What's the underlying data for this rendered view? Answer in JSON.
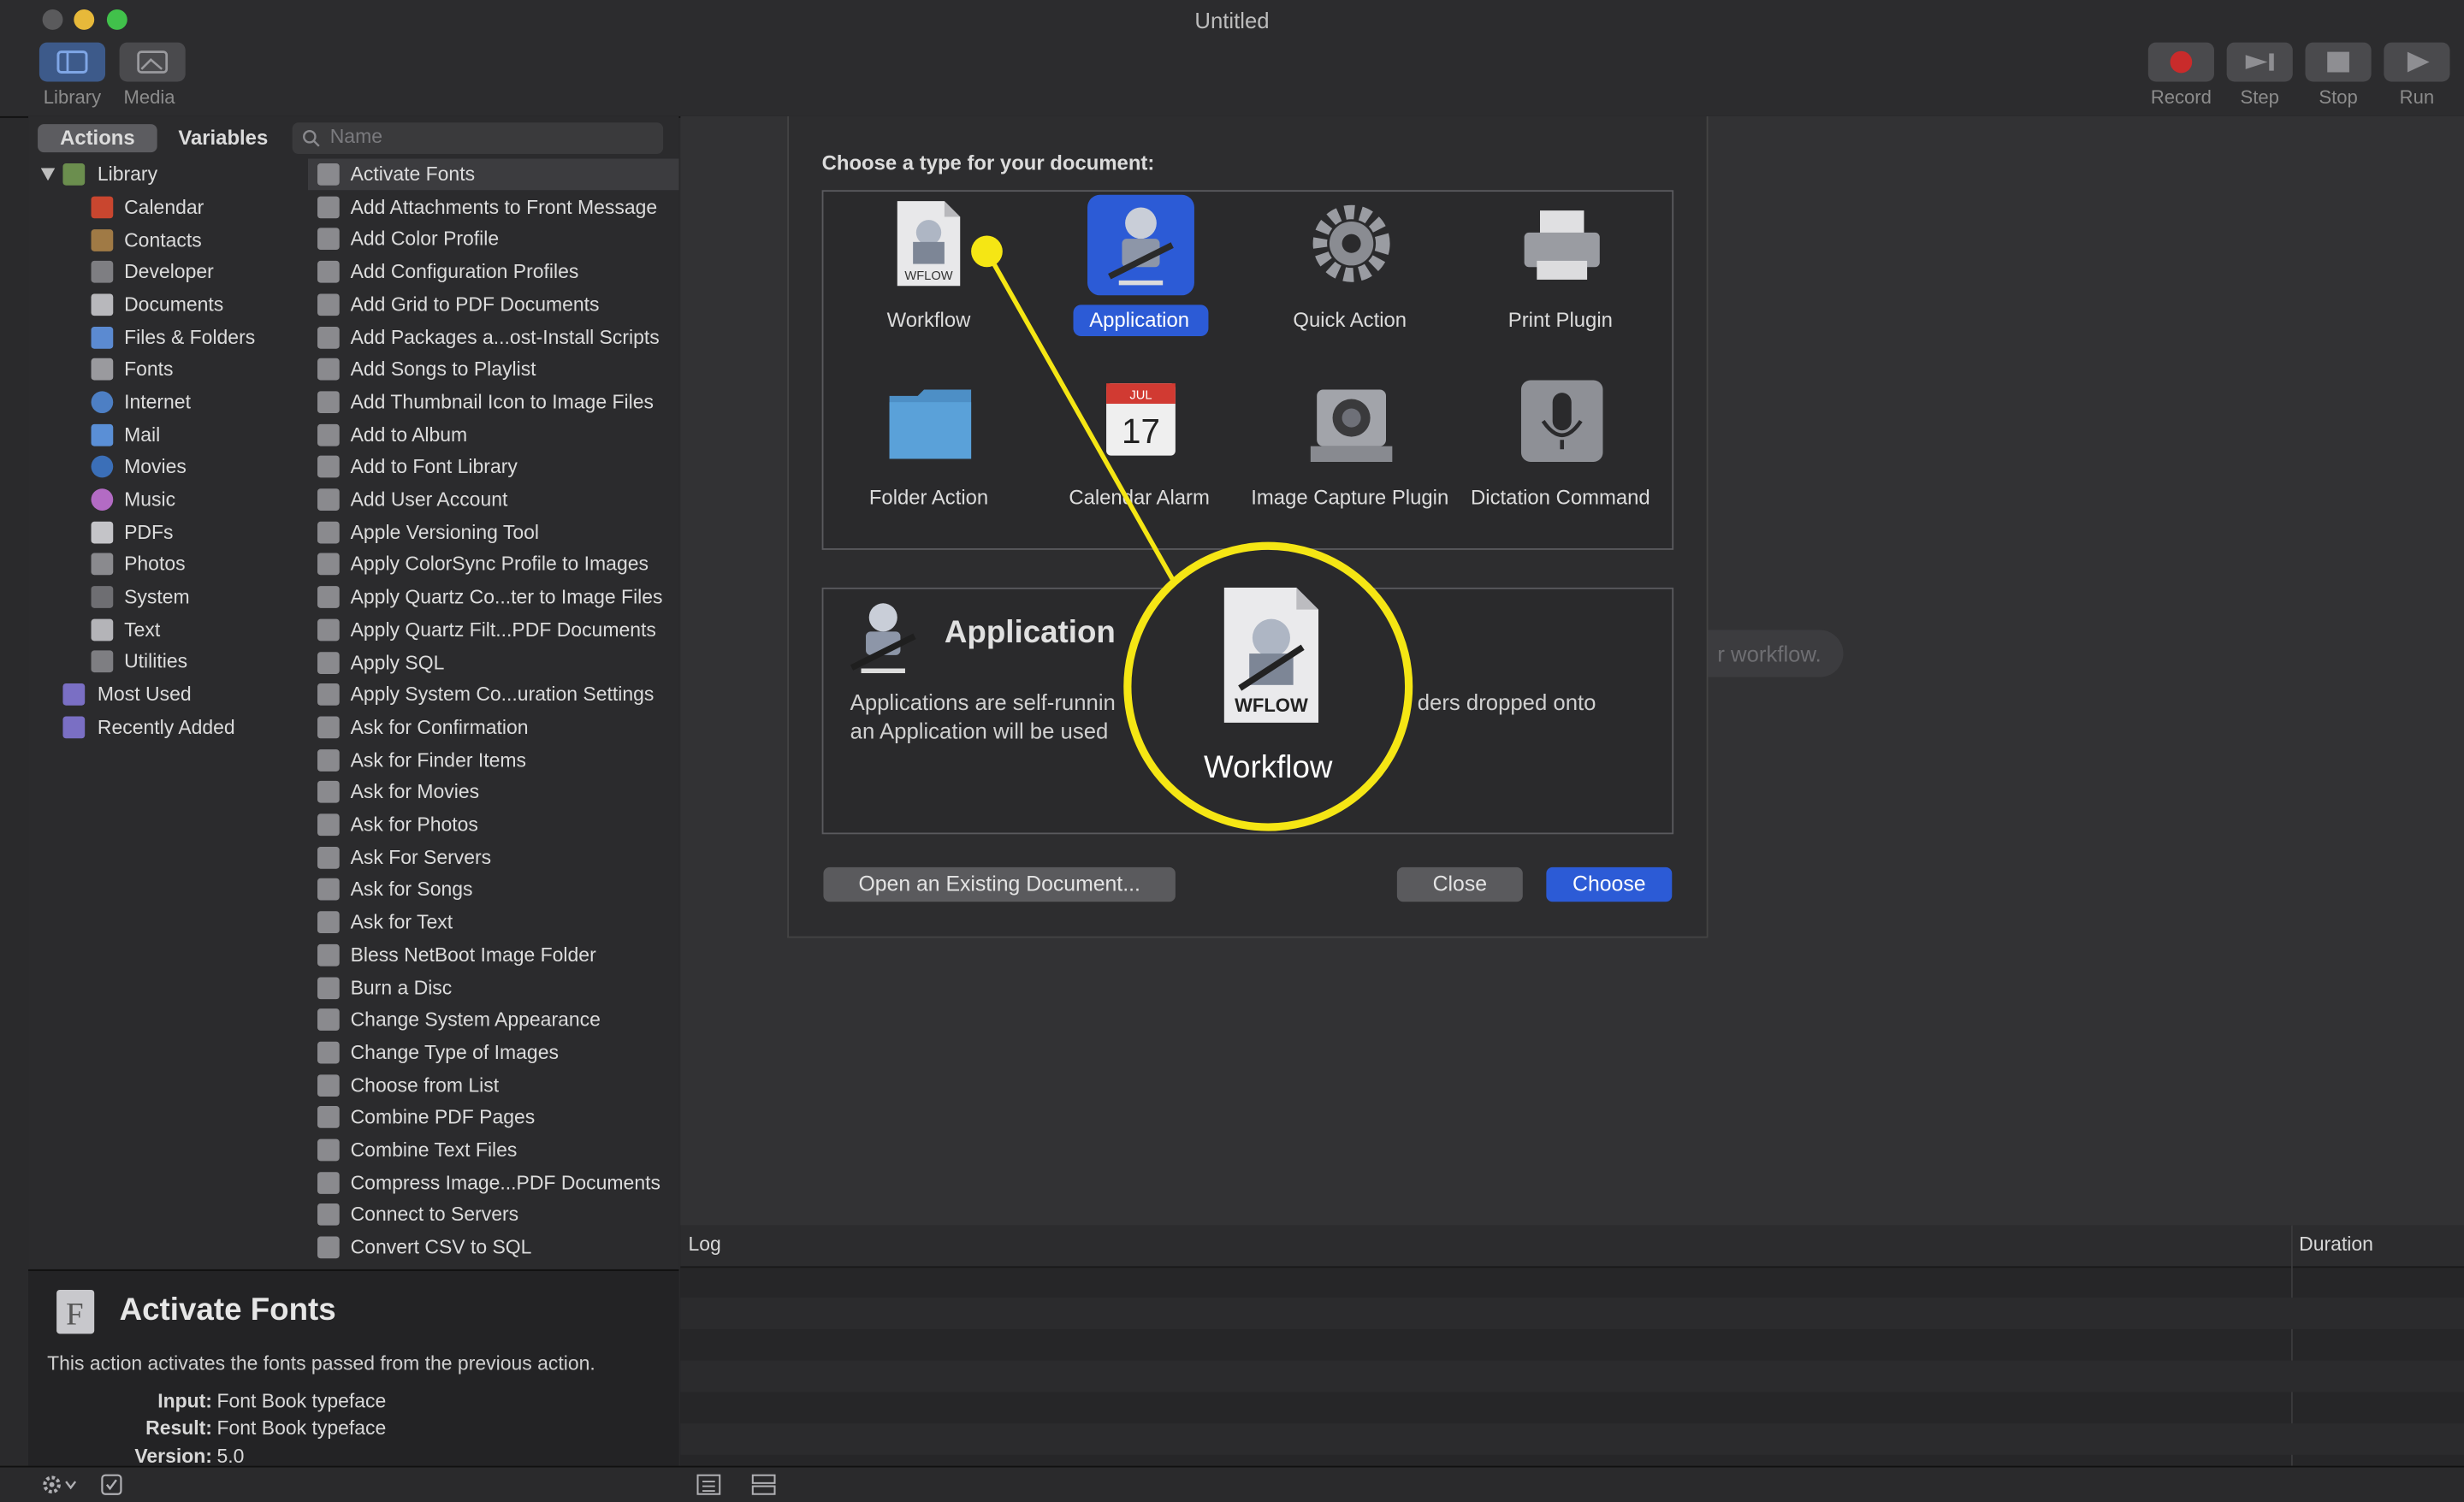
{
  "window": {
    "title": "Untitled"
  },
  "toolbar": {
    "left": [
      {
        "label": "Library"
      },
      {
        "label": "Media"
      }
    ],
    "right": [
      {
        "label": "Record"
      },
      {
        "label": "Step"
      },
      {
        "label": "Stop"
      },
      {
        "label": "Run"
      }
    ]
  },
  "library_tabs": {
    "actions": "Actions",
    "variables": "Variables"
  },
  "search": {
    "placeholder": "Name"
  },
  "library": {
    "root": "Library",
    "items": [
      "Calendar",
      "Contacts",
      "Developer",
      "Documents",
      "Files & Folders",
      "Fonts",
      "Internet",
      "Mail",
      "Movies",
      "Music",
      "PDFs",
      "Photos",
      "System",
      "Text",
      "Utilities"
    ],
    "extra": [
      "Most Used",
      "Recently Added"
    ]
  },
  "actions": [
    "Activate Fonts",
    "Add Attachments to Front Message",
    "Add Color Profile",
    "Add Configuration Profiles",
    "Add Grid to PDF Documents",
    "Add Packages a...ost-Install Scripts",
    "Add Songs to Playlist",
    "Add Thumbnail Icon to Image Files",
    "Add to Album",
    "Add to Font Library",
    "Add User Account",
    "Apple Versioning Tool",
    "Apply ColorSync Profile to Images",
    "Apply Quartz Co...ter to Image Files",
    "Apply Quartz Filt...PDF Documents",
    "Apply SQL",
    "Apply System Co...uration Settings",
    "Ask for Confirmation",
    "Ask for Finder Items",
    "Ask for Movies",
    "Ask for Photos",
    "Ask For Servers",
    "Ask for Songs",
    "Ask for Text",
    "Bless NetBoot Image Folder",
    "Burn a Disc",
    "Change System Appearance",
    "Change Type of Images",
    "Choose from List",
    "Combine PDF Pages",
    "Combine Text Files",
    "Compress Image...PDF Documents",
    "Connect to Servers",
    "Convert CSV to SQL"
  ],
  "description": {
    "title": "Activate Fonts",
    "text": "This action activates the fonts passed from the previous action.",
    "input_label": "Input:",
    "input_value": "Font Book typeface",
    "result_label": "Result:",
    "result_value": "Font Book typeface",
    "version_label": "Version:",
    "version_value": "5.0"
  },
  "dialog": {
    "prompt": "Choose a type for your document:",
    "types": [
      {
        "label": "Workflow",
        "icon": "workflow-document-icon"
      },
      {
        "label": "Application",
        "icon": "automator-robot-icon",
        "selected": true
      },
      {
        "label": "Quick Action",
        "icon": "gear-icon"
      },
      {
        "label": "Print Plugin",
        "icon": "printer-icon"
      },
      {
        "label": "Folder Action",
        "icon": "folder-icon"
      },
      {
        "label": "Calendar Alarm",
        "icon": "calendar-icon",
        "month": "JUL",
        "day": "17"
      },
      {
        "label": "Image Capture Plugin",
        "icon": "camera-icon"
      },
      {
        "label": "Dictation Command",
        "icon": "microphone-icon"
      }
    ],
    "detail_title": "Application",
    "detail_text_left": "Applications are self-runnin",
    "detail_text_left2": "an Application will be used",
    "detail_text_right": "ders dropped onto",
    "open_button": "Open an Existing Document...",
    "close_button": "Close",
    "choose_button": "Choose"
  },
  "callout": {
    "icon_text": "WFLOW",
    "label": "Workflow",
    "color": "#f5e614"
  },
  "workflow_hint": "r workflow.",
  "log": {
    "log_header": "Log",
    "duration_header": "Duration"
  },
  "colors": {
    "accent": "#2c5bd6",
    "highlight": "#f5e614"
  }
}
